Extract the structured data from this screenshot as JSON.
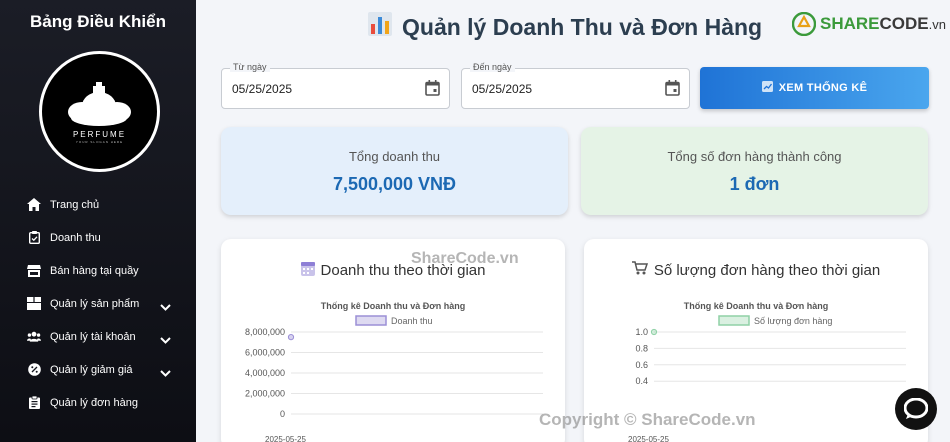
{
  "sidebar": {
    "title": "Bảng Điều Khiển",
    "logo": {
      "word": "PERFUME",
      "tagline": "YOUR SLOGAN HERE"
    },
    "items": [
      {
        "label": "Trang chủ",
        "icon": "home-icon",
        "has_submenu": false
      },
      {
        "label": "Doanh thu",
        "icon": "clipboard-check-icon",
        "has_submenu": false
      },
      {
        "label": "Bán hàng tại quầy",
        "icon": "store-icon",
        "has_submenu": false
      },
      {
        "label": "Quản lý sản phẩm",
        "icon": "box-icon",
        "has_submenu": true
      },
      {
        "label": "Quản lý tài khoản",
        "icon": "users-icon",
        "has_submenu": true
      },
      {
        "label": "Quản lý giảm giá",
        "icon": "discount-icon",
        "has_submenu": true
      },
      {
        "label": "Quản lý đơn hàng",
        "icon": "clipboard-list-icon",
        "has_submenu": false
      }
    ]
  },
  "header": {
    "title": "Quản lý Doanh Thu và Đơn Hàng",
    "title_icon": "bar-chart-icon",
    "brand": {
      "name_green": "SHARE",
      "name_dark": "CODE",
      "suffix": ".vn"
    }
  },
  "filters": {
    "from": {
      "label": "Từ ngày",
      "value": "05/25/2025"
    },
    "to": {
      "label": "Đến ngày",
      "value": "05/25/2025"
    },
    "submit_label": "XEM THỐNG KÊ"
  },
  "stats": {
    "revenue": {
      "label": "Tổng doanh thu",
      "value": "7,500,000 VNĐ"
    },
    "orders": {
      "label": "Tổng số đơn hàng thành công",
      "value": "1 đơn"
    }
  },
  "charts": {
    "revenue": {
      "card_title": "Doanh thu theo thời gian",
      "icon": "calendar-icon"
    },
    "orders": {
      "card_title": "Số lượng đơn hàng theo thời gian",
      "icon": "cart-icon"
    }
  },
  "chart_data": [
    {
      "type": "line",
      "title": "Thống kê Doanh thu và Đơn hàng",
      "categories": [
        "2025-05-25"
      ],
      "series": [
        {
          "name": "Doanh thu",
          "values": [
            7500000
          ],
          "color": "#9b8fd6"
        }
      ],
      "yticks": [
        "0",
        "2,000,000",
        "4,000,000",
        "6,000,000",
        "8,000,000"
      ],
      "ylim": [
        0,
        8000000
      ],
      "grid": true,
      "legend": "top"
    },
    {
      "type": "line",
      "title": "Thống kê Doanh thu và Đơn hàng",
      "categories": [
        "2025-05-25"
      ],
      "series": [
        {
          "name": "Số lượng đơn hàng",
          "values": [
            1
          ],
          "color": "#8fd1a6"
        }
      ],
      "yticks": [
        "0.4",
        "0.6",
        "0.8",
        "1.0"
      ],
      "ylim": [
        0,
        1
      ],
      "grid": true,
      "legend": "top"
    }
  ],
  "watermarks": {
    "top": "ShareCode.vn",
    "bottom": "Copyright © ShareCode.vn"
  },
  "colors": {
    "accent": "#1f73d6",
    "sidebar_bg": "#15171f",
    "revenue_card": "#e4effb",
    "orders_card": "#e5f3e6"
  }
}
